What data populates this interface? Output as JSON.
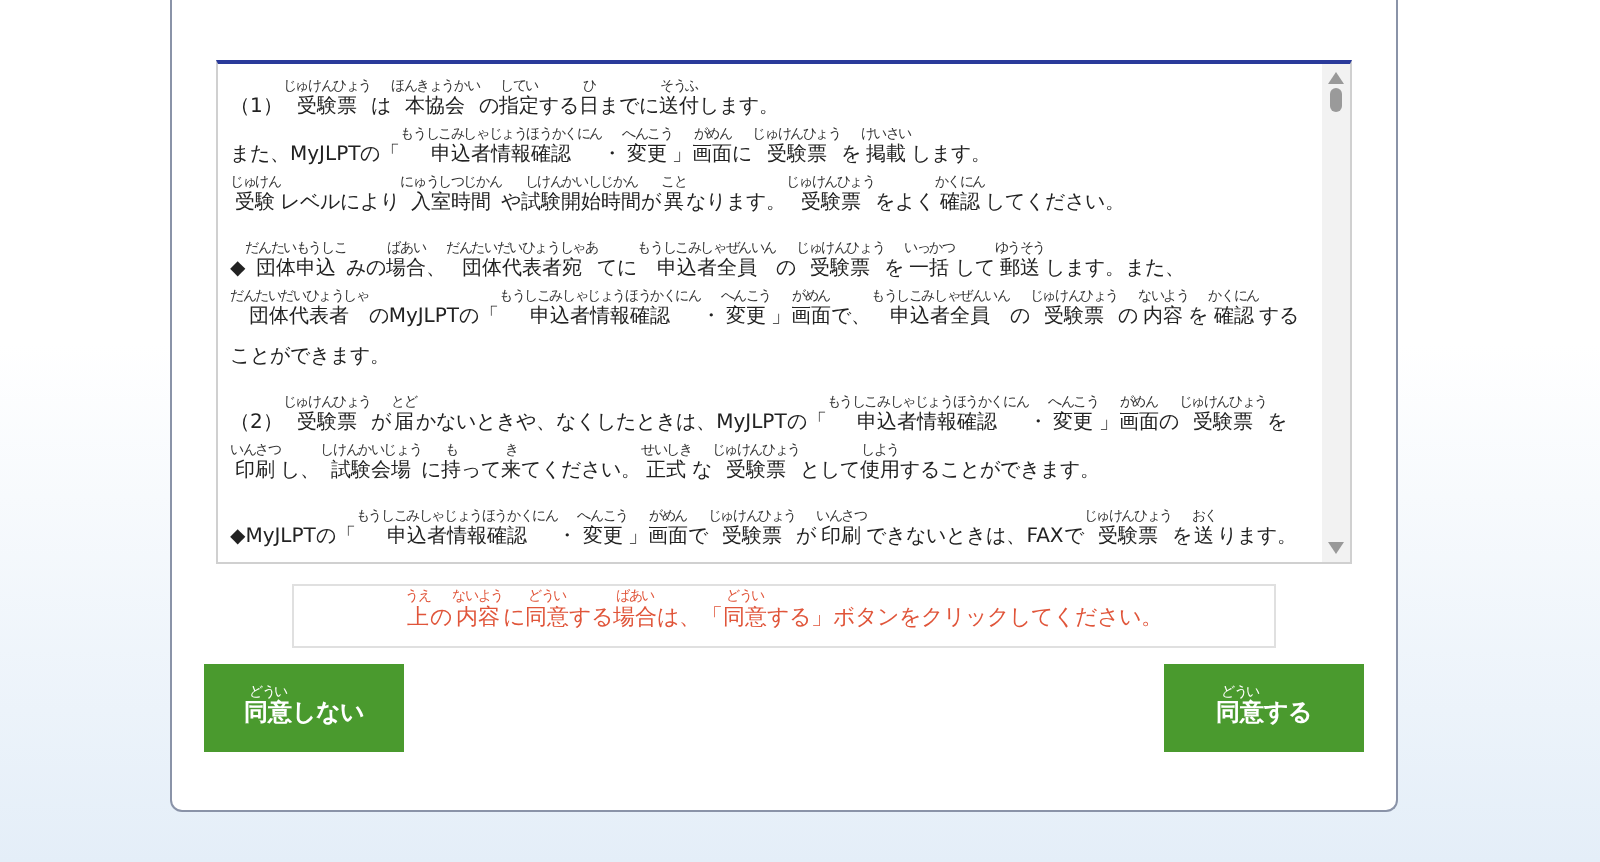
{
  "terms": {
    "paragraphs": [
      {
        "lines": [
          [
            "（1）",
            {
              "ruby": "じゅけんひょう",
              "base": "受験票"
            },
            "は",
            {
              "ruby": "ほんきょうかい",
              "base": "本協会"
            },
            "の",
            {
              "ruby": "してい",
              "base": "指定"
            },
            "する",
            {
              "ruby": "ひ",
              "base": "日"
            },
            "までに",
            {
              "ruby": "そうふ",
              "base": "送付"
            },
            "します。"
          ],
          [
            "また、MyJLPTの「",
            {
              "ruby": "もうしこみしゃじょうほうかくにん",
              "base": "申込者情報確認"
            },
            "・",
            {
              "ruby": "へんこう",
              "base": "変更"
            },
            "」",
            {
              "ruby": "がめん",
              "base": "画面"
            },
            "に",
            {
              "ruby": "じゅけんひょう",
              "base": "受験票"
            },
            "を",
            {
              "ruby": "けいさい",
              "base": "掲載"
            },
            "します。"
          ],
          [
            {
              "ruby": "じゅけん",
              "base": "受験"
            },
            "レベルにより",
            {
              "ruby": "にゅうしつじかん",
              "base": "入室時間"
            },
            "や",
            {
              "ruby": "しけんかいしじかん",
              "base": "試験開始時間"
            },
            "が",
            {
              "ruby": "こと",
              "base": "異"
            },
            "なります。",
            {
              "ruby": "じゅけんひょう",
              "base": "受験票"
            },
            "をよく",
            {
              "ruby": "かくにん",
              "base": "確認"
            },
            "してください。"
          ]
        ]
      },
      {
        "lines": [
          [
            "◆",
            {
              "ruby": "だんたいもうしこ",
              "base": "団体申込"
            },
            "みの",
            {
              "ruby": "ばあい",
              "base": "場合"
            },
            "、",
            {
              "ruby": "だんたいだいひょうしゃあ",
              "base": "団体代表者宛"
            },
            "てに",
            {
              "ruby": "もうしこみしゃぜんいん",
              "base": "申込者全員"
            },
            "の",
            {
              "ruby": "じゅけんひょう",
              "base": "受験票"
            },
            "を",
            {
              "ruby": "いっかつ",
              "base": "一括"
            },
            "して",
            {
              "ruby": "ゆうそう",
              "base": "郵送"
            },
            "します。また、",
            {
              "ruby": "だんたいだいひょうしゃ",
              "base": "団体代表者"
            },
            "のMyJLPTの「",
            {
              "ruby": "もうしこみしゃじょうほうかくにん",
              "base": "申込者情報確認"
            },
            "・",
            {
              "ruby": "へんこう",
              "base": "変更"
            },
            "」",
            {
              "ruby": "がめん",
              "base": "画面"
            },
            "で、",
            {
              "ruby": "もうしこみしゃぜんいん",
              "base": "申込者全員"
            },
            "の",
            {
              "ruby": "じゅけんひょう",
              "base": "受験票"
            },
            "の",
            {
              "ruby": "ないよう",
              "base": "内容"
            },
            "を",
            {
              "ruby": "かくにん",
              "base": "確認"
            },
            "することができます。"
          ]
        ]
      },
      {
        "lines": [
          [
            "（2）",
            {
              "ruby": "じゅけんひょう",
              "base": "受験票"
            },
            "が",
            {
              "ruby": "とど",
              "base": "届"
            },
            "かないときや、なくしたときは、MyJLPTの「",
            {
              "ruby": "もうしこみしゃじょうほうかくにん",
              "base": "申込者情報確認"
            },
            "・",
            {
              "ruby": "へんこう",
              "base": "変更"
            },
            "」",
            {
              "ruby": "がめん",
              "base": "画面"
            },
            "の",
            {
              "ruby": "じゅけんひょう",
              "base": "受験票"
            },
            "を",
            {
              "ruby": "いんさつ",
              "base": "印刷"
            },
            "し、",
            {
              "ruby": "しけんかいじょう",
              "base": "試験会場"
            },
            "に",
            {
              "ruby": "も",
              "base": "持"
            },
            "って",
            {
              "ruby": "き",
              "base": "来"
            },
            "てください。",
            {
              "ruby": "せいしき",
              "base": "正式"
            },
            "な",
            {
              "ruby": "じゅけんひょう",
              "base": "受験票"
            },
            "として",
            {
              "ruby": "しよう",
              "base": "使用"
            },
            "することができます。"
          ]
        ]
      },
      {
        "lines": [
          [
            "◆MyJLPTの「",
            {
              "ruby": "もうしこみしゃじょうほうかくにん",
              "base": "申込者情報確認"
            },
            "・",
            {
              "ruby": "へんこう",
              "base": "変更"
            },
            "」",
            {
              "ruby": "がめん",
              "base": "画面"
            },
            "で",
            {
              "ruby": "じゅけんひょう",
              "base": "受験票"
            },
            "が",
            {
              "ruby": "いんさつ",
              "base": "印刷"
            },
            "できないときは、FAXで",
            {
              "ruby": "じゅけんひょう",
              "base": "受験票"
            },
            "を",
            {
              "ruby": "おく",
              "base": "送"
            },
            "ります。"
          ]
        ]
      }
    ]
  },
  "notice": [
    {
      "ruby": "うえ",
      "base": "上"
    },
    "の",
    {
      "ruby": "ないよう",
      "base": "内容"
    },
    "に",
    {
      "ruby": "どうい",
      "base": "同意"
    },
    "する",
    {
      "ruby": "ばあい",
      "base": "場合"
    },
    "は、「",
    {
      "ruby": "どうい",
      "base": "同意"
    },
    "する」ボタンをクリックしてください。"
  ],
  "buttons": [
    {
      "kind": "decline",
      "label": [
        {
          "ruby": "どうい",
          "base": "同意"
        },
        "しない"
      ]
    },
    {
      "kind": "agree",
      "label": [
        {
          "ruby": "どうい",
          "base": "同意"
        },
        "する"
      ]
    }
  ]
}
